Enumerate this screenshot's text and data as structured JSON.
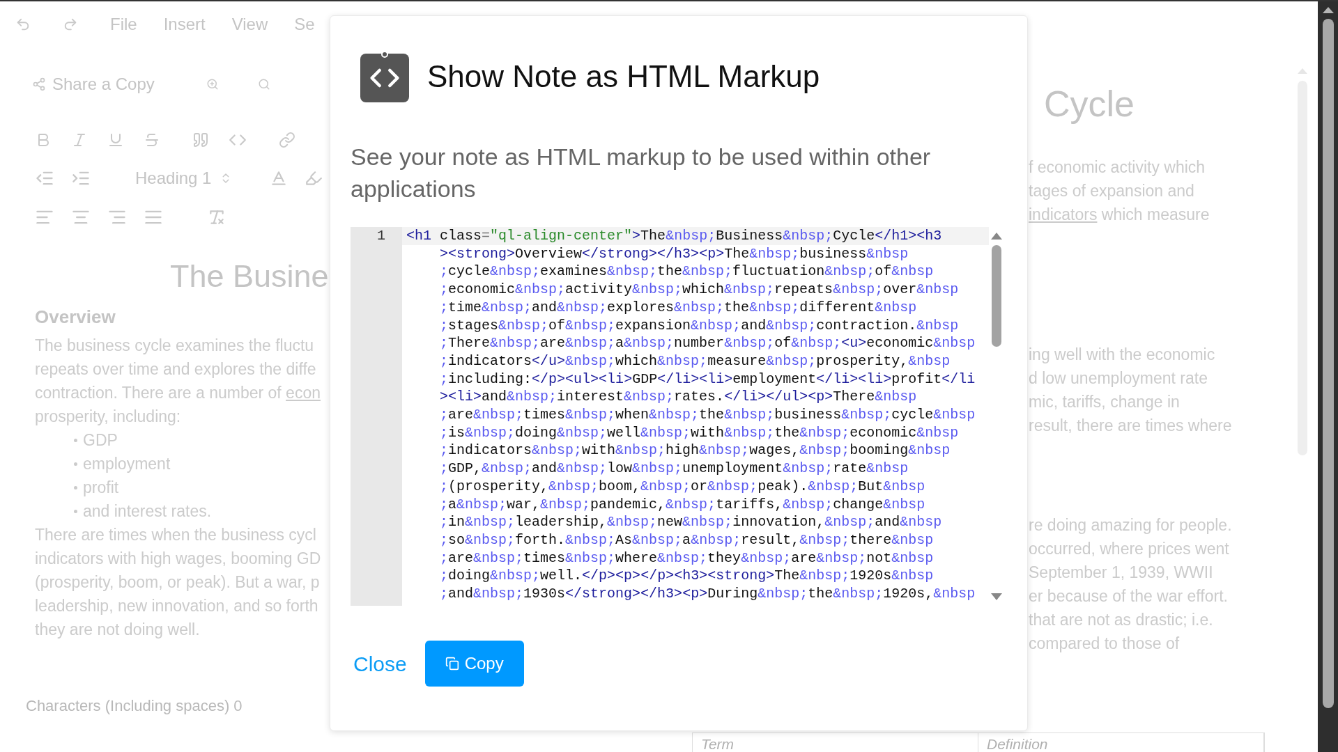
{
  "menu": {
    "items": [
      "File",
      "Insert",
      "View",
      "Se"
    ]
  },
  "share": {
    "label": "Share a Copy"
  },
  "toolbar": {
    "heading_select": "Heading 1"
  },
  "document_left": {
    "title": "The Busine",
    "heading": "Overview",
    "paragraph_1": [
      "The business cycle examines the fluctu",
      "repeats over time and explores the diffe",
      {
        "parts": [
          {
            "text": "contraction. There are a number of ",
            "underline": false
          },
          {
            "text": "econ",
            "underline": true
          }
        ]
      },
      "prosperity, including:"
    ],
    "bullets": [
      "GDP",
      "employment",
      "profit",
      "and interest rates."
    ],
    "paragraph_2": [
      "There are times when the business cycl",
      "indicators with high wages, booming GD",
      "(prosperity, boom, or peak). But a war, p",
      "leadership, new innovation, and so forth",
      "they are not doing well."
    ]
  },
  "status": {
    "label": "Characters (Including spaces)",
    "count": "0"
  },
  "document_right": {
    "title": "Cycle",
    "paragraph_1": [
      "f economic activity which",
      "tages of expansion and",
      {
        "parts": [
          {
            "text": "indicators",
            "underline": true
          },
          {
            "text": " which measure",
            "underline": false
          }
        ]
      }
    ],
    "paragraph_2": [
      "ing well with the economic",
      "d low unemployment rate",
      "mic, tariffs, change in",
      "result, there are times where"
    ],
    "paragraph_3": [
      "re doing amazing for people.",
      "occurred, where prices went",
      "September 1, 1939, WWII",
      "er because of the war effort.",
      "that are not as drastic; i.e.",
      "compared to those of"
    ]
  },
  "table": {
    "columns": [
      "Term",
      "Definition"
    ]
  },
  "dialog": {
    "title": "Show Note as HTML Markup",
    "description": "See your note as HTML markup to be used within other applications",
    "code_editor": {
      "line_number": "1",
      "lines": [
        "<h1 class=\"ql-align-center\">The&nbsp;Business&nbsp;Cycle</h1><h3",
        "><strong>Overview</strong></h3><p>The&nbsp;business&nbsp",
        ";cycle&nbsp;examines&nbsp;the&nbsp;fluctuation&nbsp;of&nbsp",
        ";economic&nbsp;activity&nbsp;which&nbsp;repeats&nbsp;over&nbsp",
        ";time&nbsp;and&nbsp;explores&nbsp;the&nbsp;different&nbsp",
        ";stages&nbsp;of&nbsp;expansion&nbsp;and&nbsp;contraction.&nbsp",
        ";There&nbsp;are&nbsp;a&nbsp;number&nbsp;of&nbsp;<u>economic&nbsp",
        ";indicators</u>&nbsp;which&nbsp;measure&nbsp;prosperity,&nbsp",
        ";including:</p><ul><li>GDP</li><li>employment</li><li>profit</li",
        "><li>and&nbsp;interest&nbsp;rates.</li></ul><p>There&nbsp",
        ";are&nbsp;times&nbsp;when&nbsp;the&nbsp;business&nbsp;cycle&nbsp",
        ";is&nbsp;doing&nbsp;well&nbsp;with&nbsp;the&nbsp;economic&nbsp",
        ";indicators&nbsp;with&nbsp;high&nbsp;wages,&nbsp;booming&nbsp",
        ";GDP,&nbsp;and&nbsp;low&nbsp;unemployment&nbsp;rate&nbsp",
        ";(prosperity,&nbsp;boom,&nbsp;or&nbsp;peak).&nbsp;But&nbsp",
        ";a&nbsp;war,&nbsp;pandemic,&nbsp;tariffs,&nbsp;change&nbsp",
        ";in&nbsp;leadership,&nbsp;new&nbsp;innovation,&nbsp;and&nbsp",
        ";so&nbsp;forth.&nbsp;As&nbsp;a&nbsp;result,&nbsp;there&nbsp",
        ";are&nbsp;times&nbsp;where&nbsp;they&nbsp;are&nbsp;not&nbsp",
        ";doing&nbsp;well.</p><p></p><h3><strong>The&nbsp;1920s&nbsp",
        ";and&nbsp;1930s</strong></h3><p>During&nbsp;the&nbsp;1920s,&nbsp"
      ]
    },
    "buttons": [
      {
        "kind": "link",
        "label": "Close"
      },
      {
        "kind": "primary",
        "label": "Copy"
      }
    ]
  }
}
